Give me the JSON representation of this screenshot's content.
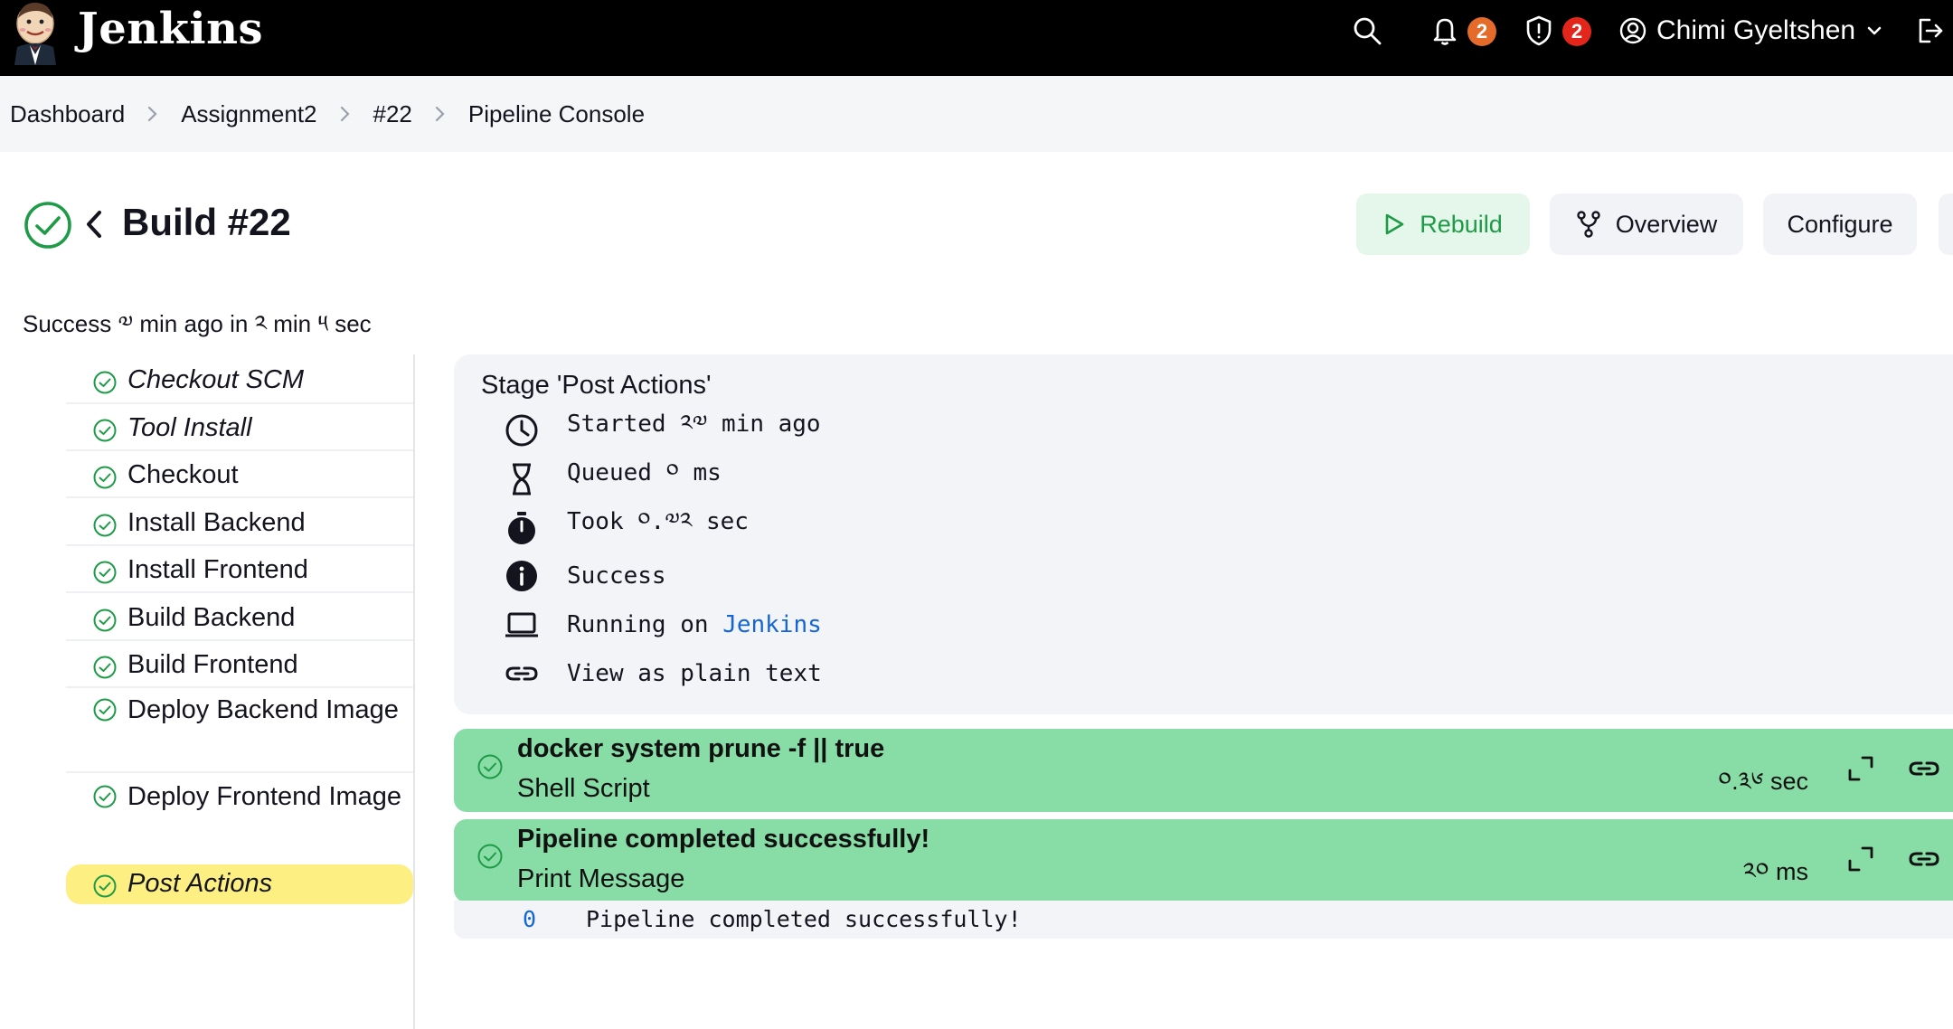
{
  "header": {
    "brand": "Jenkins",
    "notifications_count": "2",
    "security_count": "2",
    "user_name": "Chimi Gyeltshen"
  },
  "breadcrumb": [
    "Dashboard",
    "Assignment2",
    "#22",
    "Pipeline Console"
  ],
  "build": {
    "title": "Build #22",
    "summary": "Success ༧ min ago in ༢ min ༥ sec"
  },
  "actions": {
    "rebuild": "Rebuild",
    "overview": "Overview",
    "configure": "Configure"
  },
  "stages": [
    {
      "label": "Checkout SCM",
      "italic": true
    },
    {
      "label": "Tool Install",
      "italic": true
    },
    {
      "label": "Checkout",
      "italic": false
    },
    {
      "label": "Install Backend",
      "italic": false
    },
    {
      "label": "Install Frontend",
      "italic": false
    },
    {
      "label": "Build Backend",
      "italic": false
    },
    {
      "label": "Build Frontend",
      "italic": false
    },
    {
      "label": "Deploy Backend Image",
      "italic": false
    },
    {
      "label": "Deploy Frontend Image",
      "italic": false
    },
    {
      "label": "Post Actions",
      "italic": true,
      "selected": true
    }
  ],
  "stage_detail": {
    "heading": "Stage 'Post Actions'",
    "started": "Started ༢༧ min ago",
    "queued": "Queued ༠ ms",
    "took": "Took ༠.༧༢ sec",
    "status": "Success",
    "running_prefix": "Running on ",
    "running_node": "Jenkins",
    "view_plain": "View as plain text"
  },
  "steps": [
    {
      "title": "docker system prune -f || true",
      "subtitle": "Shell Script",
      "duration": "༠.༣༦ sec"
    },
    {
      "title": "Pipeline completed successfully!",
      "subtitle": "Print Message",
      "duration": "༢༠ ms"
    }
  ],
  "log": [
    {
      "line": "0",
      "text": "Pipeline completed successfully!"
    }
  ],
  "colors": {
    "header_bg": "#000000",
    "success": "#1e9b47",
    "step_bg": "#88dca6",
    "selected_stage": "#fdef82",
    "link": "#1466d6",
    "badge_orange": "#e56b2a",
    "badge_red": "#e4251b"
  }
}
